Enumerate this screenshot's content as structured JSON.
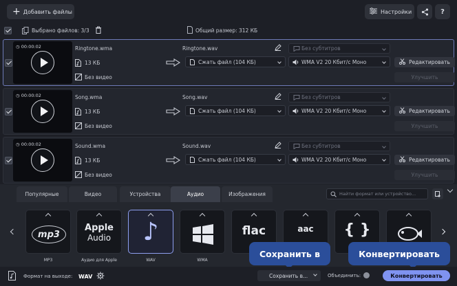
{
  "toolbar": {
    "add_files_label": "Добавить файлы",
    "settings_label": "Настройки",
    "help_label": "?"
  },
  "summary": {
    "selected_label": "Выбрано файлов: 3/3",
    "total_size_label": "Общий размер: 312 КБ"
  },
  "files": [
    {
      "duration": "00:00:02",
      "source_name": "Ringtone.wma",
      "source_size": "13 КБ",
      "no_video": "Без видео",
      "output_name": "Ringtone.wav",
      "compress": "Сжать файл (104 КБ)",
      "audio_codec": "WMA V2 20 Кбит/с Моно",
      "subtitles": "Без субтитров",
      "edit_label": "Редактировать",
      "enhance_label": "Улучшить"
    },
    {
      "duration": "00:00:02",
      "source_name": "Song.wma",
      "source_size": "13 КБ",
      "no_video": "Без видео",
      "output_name": "Song.wav",
      "compress": "Сжать файл (104 КБ)",
      "audio_codec": "WMA V2 20 Кбит/с Моно",
      "subtitles": "Без субтитров",
      "edit_label": "Редактировать",
      "enhance_label": "Улучшить"
    },
    {
      "duration": "00:00:02",
      "source_name": "Sound.wma",
      "source_size": "13 КБ",
      "no_video": "Без видео",
      "output_name": "Sound.wav",
      "compress": "Сжать файл (104 КБ)",
      "audio_codec": "WMA V2 20 Кбит/с Моно",
      "subtitles": "Без субтитров",
      "edit_label": "Редактировать",
      "enhance_label": "Улучшить"
    }
  ],
  "tabs": [
    {
      "label": "Популярные",
      "active": false
    },
    {
      "label": "Видео",
      "active": false
    },
    {
      "label": "Устройства",
      "active": false
    },
    {
      "label": "Аудио",
      "active": true
    },
    {
      "label": "Изображения",
      "active": false
    }
  ],
  "search": {
    "placeholder": "Найти формат или устройство..."
  },
  "formats": [
    {
      "icon": "mp3-icon",
      "logo": "mp3",
      "label": "MP3"
    },
    {
      "icon": "apple-audio-icon",
      "logo_top": "Apple",
      "logo_bottom": "Audio",
      "label": "Аудио для Apple"
    },
    {
      "icon": "music-note-icon",
      "logo": "♪",
      "label": "WAV",
      "selected": true
    },
    {
      "icon": "windows-icon",
      "logo": "",
      "label": "WMA"
    },
    {
      "icon": "flac-icon",
      "logo": "flac",
      "label": ""
    },
    {
      "icon": "aac-icon",
      "logo": "aac",
      "label": ""
    },
    {
      "icon": "ogg-braces-icon",
      "logo": "{ }",
      "label": ""
    },
    {
      "icon": "fish-icon",
      "logo": "",
      "label": ""
    }
  ],
  "bottom": {
    "output_format_label": "Формат на выходе:",
    "output_format_value": "WAV",
    "save_to_label": "Сохранить в...",
    "merge_label": "Объединить:",
    "convert_label": "Конвертировать"
  },
  "tooltips": {
    "save_tip": "Сохранить в",
    "convert_tip": "Конвертировать"
  },
  "colors": {
    "background": "#1d1f26",
    "accent": "#8e9ff0",
    "convert_button": "#7f93f0",
    "tooltip": "#2b4e9a"
  }
}
